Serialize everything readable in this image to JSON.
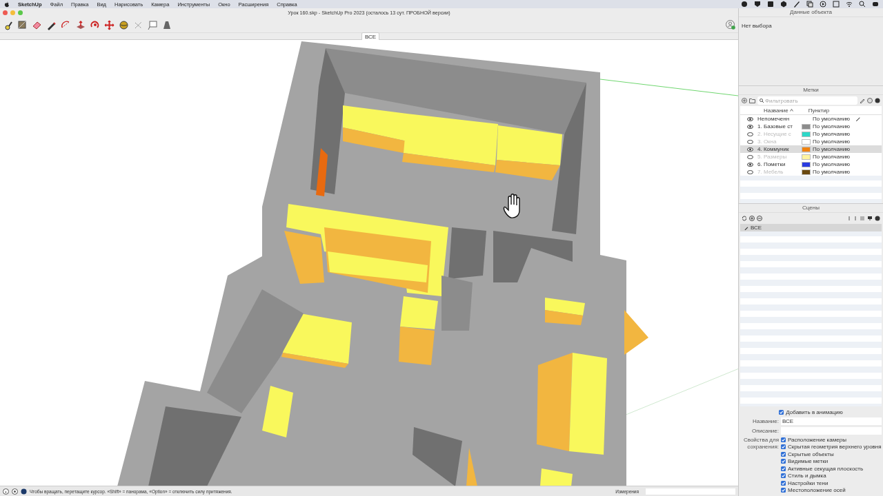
{
  "menu_bar": {
    "app": "SketchUp",
    "items": [
      "Файл",
      "Правка",
      "Вид",
      "Нарисовать",
      "Камера",
      "Инструменты",
      "Окно",
      "Расширения",
      "Справка"
    ]
  },
  "window": {
    "title": "Урок 160.skp - SketchUp Pro 2023 (осталось 13 сут. ПРОБНОЙ версии)"
  },
  "scene_tabs": [
    {
      "label": "ВСЕ",
      "selected": true
    }
  ],
  "entity_info": {
    "title": "Данные объекта",
    "selection": "Нет выбора"
  },
  "tags": {
    "title": "Метки",
    "filter_placeholder": "Фильтровать",
    "columns": [
      "Название",
      "Пунктир"
    ],
    "rows": [
      {
        "name": "Непомеченн",
        "dash": "По умолчанию",
        "visible": true,
        "selected": false,
        "active": true
      },
      {
        "name": "1. Базовые ст",
        "dash": "По умолчанию",
        "visible": true,
        "selected": false,
        "active": false,
        "color": "#8c8c8c"
      },
      {
        "name": "2. Несущие с",
        "dash": "По умолчанию",
        "visible": false,
        "selected": false,
        "active": false,
        "color": "#2ed8c8"
      },
      {
        "name": "3. Окна",
        "dash": "По умолчанию",
        "visible": false,
        "selected": false,
        "active": false,
        "color": "#ffffff"
      },
      {
        "name": "4. Коммуник",
        "dash": "По умолчанию",
        "visible": true,
        "selected": true,
        "active": false,
        "color": "#f0820f"
      },
      {
        "name": "5. Размеры",
        "dash": "По умолчанию",
        "visible": false,
        "selected": false,
        "active": false,
        "color": "#fff4a0"
      },
      {
        "name": "6. Пометки",
        "dash": "По умолчанию",
        "visible": true,
        "selected": false,
        "active": false,
        "color": "#2a3be0"
      },
      {
        "name": "7. Мебель",
        "dash": "По умолчанию",
        "visible": false,
        "selected": false,
        "active": false,
        "color": "#6b4a10"
      }
    ]
  },
  "scenes": {
    "title": "Сцены",
    "items": [
      {
        "name": "ВСЕ",
        "selected": true
      }
    ],
    "add_to_animation": {
      "label": "Добавить в анимацию",
      "checked": true
    },
    "name_label": "Название:",
    "name_value": "ВСЕ",
    "description_label": "Описание:",
    "properties_label": "Свойства для сохранения:",
    "properties": [
      {
        "label": "Расположение камеры",
        "checked": true
      },
      {
        "label": "Скрытая геометрия верхнего уровня",
        "checked": true
      },
      {
        "label": "Скрытые объекты",
        "checked": true
      },
      {
        "label": "Видимые метки",
        "checked": true
      },
      {
        "label": "Активные секущая плоскость",
        "checked": true
      },
      {
        "label": "Стиль и дымка",
        "checked": true
      },
      {
        "label": "Настройки тени",
        "checked": true
      },
      {
        "label": "Местоположение осей",
        "checked": true
      }
    ]
  },
  "status_bar": {
    "hint": "Чтобы вращать, перетащите курсор. «Shift» = панорама, «Option» = отключить силу притяжения.",
    "measurements_label": "Измерения"
  }
}
